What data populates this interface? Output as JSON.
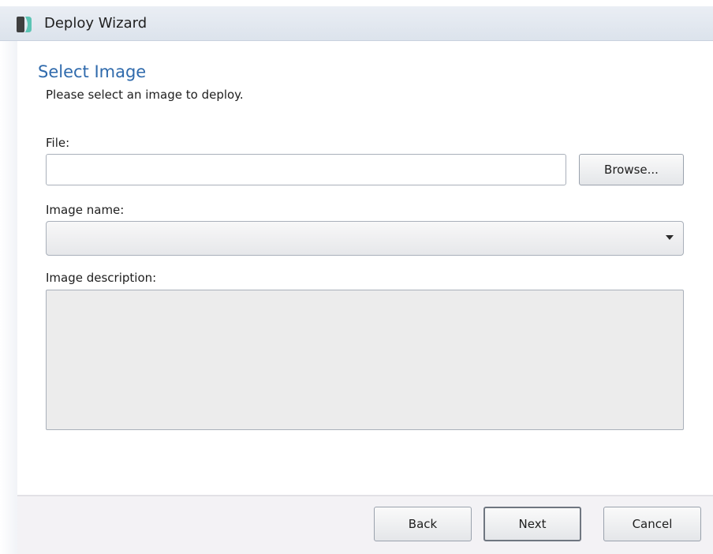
{
  "window": {
    "title": "Deploy Wizard",
    "icon": "deploy-wizard-app-icon"
  },
  "page": {
    "heading": "Select Image",
    "subheading": "Please select an image to deploy."
  },
  "form": {
    "file_label": "File:",
    "file_value": "",
    "browse_label": "Browse...",
    "image_name_label": "Image name:",
    "image_name_value": "",
    "image_description_label": "Image description:",
    "image_description_value": ""
  },
  "footer": {
    "back_label": "Back",
    "next_label": "Next",
    "cancel_label": "Cancel"
  },
  "colors": {
    "heading": "#2f6aac",
    "titlebar": "#dce3ec",
    "description_background": "#ececec",
    "footer_background": "#f3f2f5"
  }
}
